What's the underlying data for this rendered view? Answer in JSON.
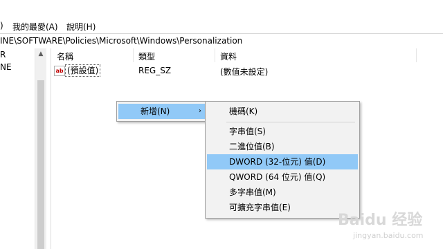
{
  "menubar": {
    "items": [
      ")",
      "我的最愛(A)",
      "說明(H)"
    ]
  },
  "address": {
    "path": "INE\\SOFTWARE\\Policies\\Microsoft\\Windows\\Personalization"
  },
  "tree": {
    "nodes": [
      "R",
      "NE"
    ]
  },
  "list": {
    "headers": [
      "名稱",
      "類型",
      "資料"
    ],
    "rows": [
      {
        "name": "(預設值)",
        "type": "REG_SZ",
        "data": "(數值未設定)",
        "icon": "string-value-icon"
      }
    ]
  },
  "context_menu": {
    "new_label": "新增(N)",
    "arrow": "›"
  },
  "submenu": {
    "key": "機碼(K)",
    "string": "字串值(S)",
    "binary": "二進位值(B)",
    "dword": "DWORD (32-位元) 值(D)",
    "qword": "QWORD (64 位元) 值(Q)",
    "multi_string": "多字串值(M)",
    "expandable_string": "可擴充字串值(E)"
  },
  "colors": {
    "highlight": "#91c9f7",
    "menu_bg": "#f2f2f2"
  },
  "watermark": {
    "brand": "Baidu 经验",
    "url": "jingyan.baidu.com"
  }
}
